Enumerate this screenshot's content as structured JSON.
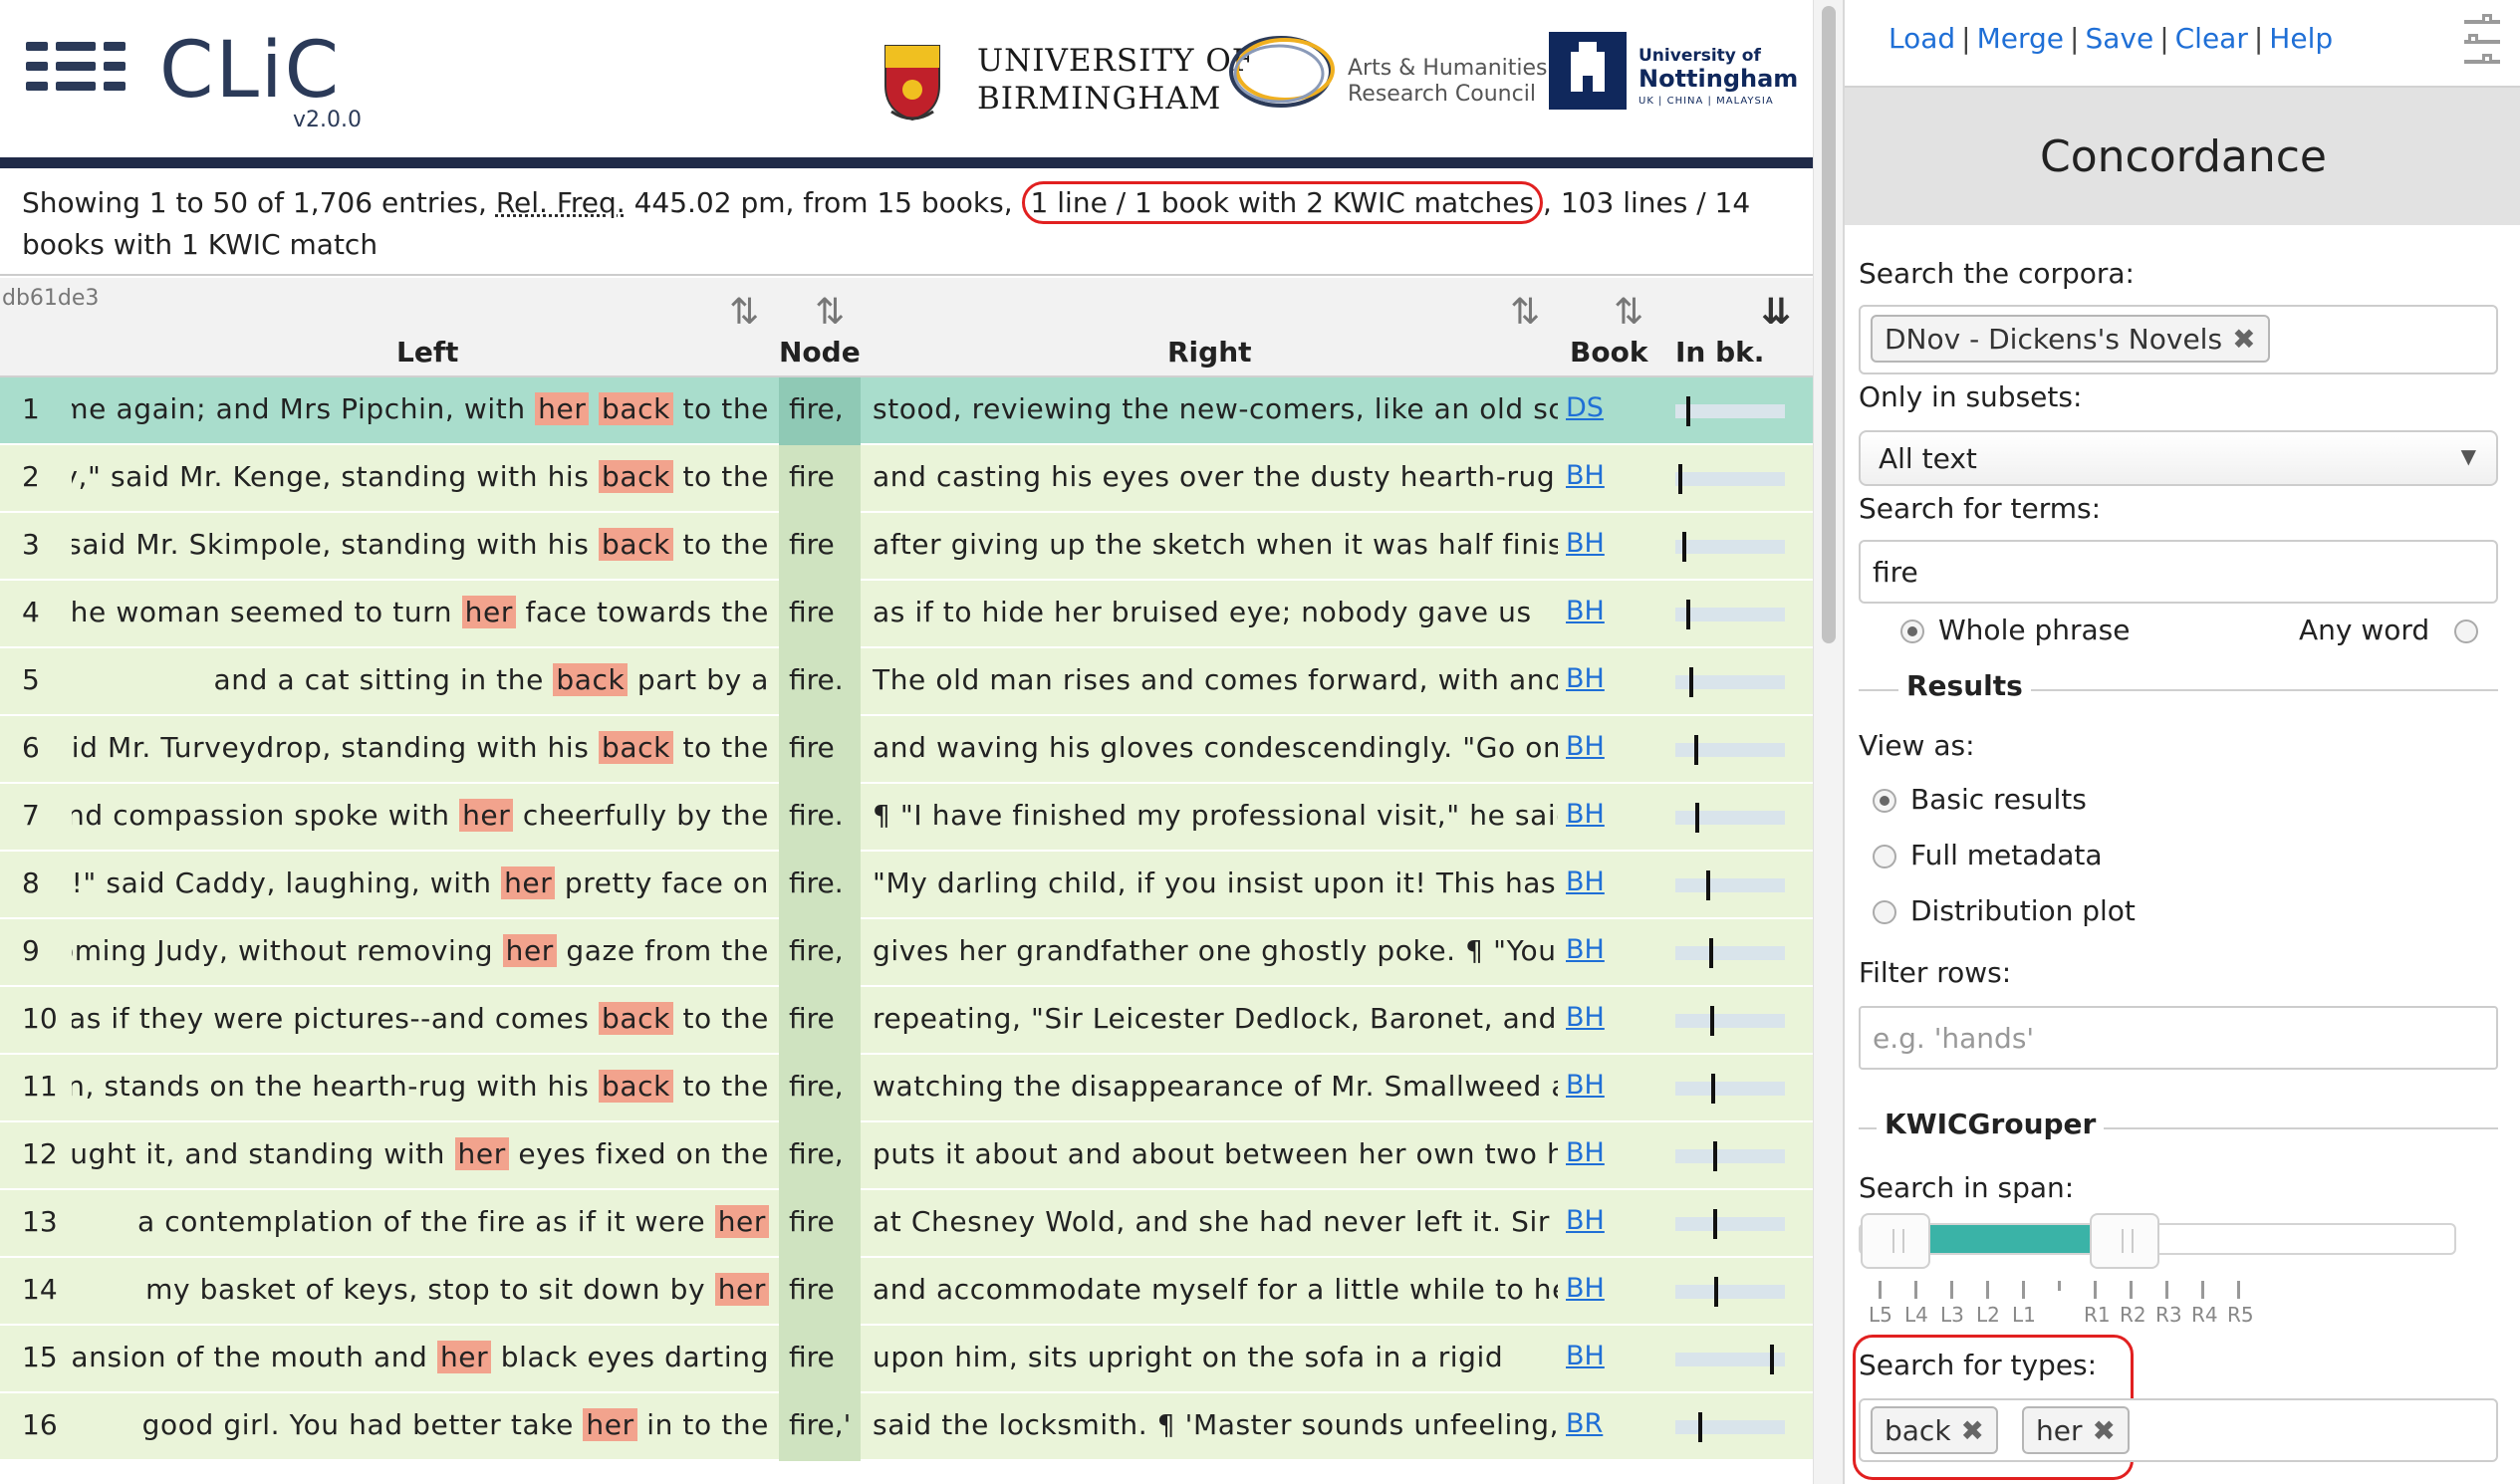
{
  "app": {
    "name": "CLiC",
    "version": "v2.0.0",
    "partners": {
      "birmingham_line1": "UNIVERSITY OF",
      "birmingham_line2": "BIRMINGHAM",
      "ahrc_line1": "Arts & Humanities",
      "ahrc_line2": "Research Council",
      "nottingham_line1": "University of",
      "nottingham_line2": "Nottingham",
      "nottingham_line3": "UK | CHINA | MALAYSIA"
    }
  },
  "summary": {
    "prefix": "Showing 1 to 50 of 1,706 entries, ",
    "relfreq_label": "Rel. Freq.",
    "middle": " 445.02 pm, from 15 books, ",
    "kwic_highlight": "1 line / 1 book with 2 KWIC matches",
    "suffix": ", 103 lines / 14 books with 1 KWIC match"
  },
  "table": {
    "hash": "db61de3",
    "headers": {
      "left": "Left",
      "node": "Node",
      "right": "Right",
      "book": "Book",
      "in_book": "In bk."
    },
    "sort_icon": "⇅",
    "sort_desc_icon": "⇊",
    "rows": [
      {
        "num": "1",
        "left": "ome again; and Mrs Pipchin, with |her| |back| to the",
        "node": "fire,",
        "right": "stood, reviewing the new-comers, like an old soldi",
        "book": "DS",
        "pos": 0.1,
        "selected": true
      },
      {
        "num": "2",
        "left": "by,\" said Mr. Kenge, standing with his |back| to the",
        "node": "fire",
        "right": "and casting his eyes over the dusty hearth-rug as",
        "book": "BH",
        "pos": 0.03,
        "selected": false
      },
      {
        "num": "3",
        "left": "\" said Mr. Skimpole, standing with his |back| to the",
        "node": "fire",
        "right": "after giving up the sketch when it was half finishe",
        "book": "BH",
        "pos": 0.07,
        "selected": false
      },
      {
        "num": "4",
        "left": "the woman seemed to turn |her| face towards the",
        "node": "fire",
        "right": "as if to hide her bruised eye; nobody gave us",
        "book": "BH",
        "pos": 0.1,
        "selected": false
      },
      {
        "num": "5",
        "left": "and a cat sitting in the |back| part by a",
        "node": "fire.",
        "right": "The old man rises and comes forward, with anothe",
        "book": "BH",
        "pos": 0.13,
        "selected": false
      },
      {
        "num": "6",
        "left": "said Mr. Turveydrop, standing with his |back| to the",
        "node": "fire",
        "right": "and waving his gloves condescendingly. \"Go on, m",
        "book": "BH",
        "pos": 0.18,
        "selected": false
      },
      {
        "num": "7",
        "left": "and compassion spoke with |her| cheerfully by the",
        "node": "fire.",
        "right": "¶ \"I have finished my professional visit,\" he said, c",
        "book": "BH",
        "pos": 0.19,
        "selected": false
      },
      {
        "num": "8",
        "left": "ng!\" said Caddy, laughing, with |her| pretty face on",
        "node": "fire.",
        "right": "\"My darling child, if you insist upon it! This has",
        "book": "BH",
        "pos": 0.29,
        "selected": false
      },
      {
        "num": "9",
        "left": "looming Judy, without removing |her| gaze from the",
        "node": "fire,",
        "right": "gives her grandfather one ghostly poke. ¶ \"You se",
        "book": "BH",
        "pos": 0.32,
        "selected": false
      },
      {
        "num": "10",
        "left": "as if they were pictures--and comes |back| to the",
        "node": "fire",
        "right": "repeating, \"Sir Leicester Dedlock, Baronet, and Ma",
        "book": "BH",
        "pos": 0.33,
        "selected": false
      },
      {
        "num": "11",
        "left": "ion, stands on the hearth-rug with his |back| to the",
        "node": "fire,",
        "right": "watching the disappearance of Mr. Smallweed and",
        "book": "BH",
        "pos": 0.34,
        "selected": false
      },
      {
        "num": "12",
        "left": "caught it, and standing with |her| eyes fixed on the",
        "node": "fire,",
        "right": "puts it about and about between her own two han",
        "book": "BH",
        "pos": 0.36,
        "selected": false
      },
      {
        "num": "13",
        "left": "a contemplation of the fire as if it were |her|",
        "node": "fire",
        "right": "at Chesney Wold, and she had never left it. Sir",
        "book": "BH",
        "pos": 0.36,
        "selected": false
      },
      {
        "num": "14",
        "left": "my basket of keys, stop to sit down by |her|",
        "node": "fire",
        "right": "and accommodate myself for a little while to her, a",
        "book": "BH",
        "pos": 0.37,
        "selected": false
      },
      {
        "num": "15",
        "left": "xpansion of the mouth and |her| black eyes darting",
        "node": "fire",
        "right": "upon him, sits upright on the sofa in a rigid",
        "book": "BH",
        "pos": 0.9,
        "selected": false
      },
      {
        "num": "16",
        "left": "good girl. You had better take |her| in to the",
        "node": "fire,'",
        "right": "said the locksmith. ¶ 'Master sounds unfeeling, mi",
        "book": "BR",
        "pos": 0.22,
        "selected": false
      }
    ]
  },
  "panel": {
    "links": [
      "Load",
      "Merge",
      "Save",
      "Clear",
      "Help"
    ],
    "title": "Concordance",
    "search_corpora_label": "Search the corpora:",
    "corpus_tag": "DNov - Dickens's Novels",
    "subsets_label": "Only in subsets:",
    "subset_value": "All text",
    "terms_label": "Search for terms:",
    "terms_value": "fire",
    "whole_phrase": "Whole phrase",
    "any_word": "Any word",
    "results_legend": "Results",
    "view_as_label": "View as:",
    "view_options": [
      "Basic results",
      "Full metadata",
      "Distribution plot"
    ],
    "view_selected": 0,
    "filter_label": "Filter rows:",
    "filter_placeholder": "e.g. 'hands'",
    "kwic_legend": "KWICGrouper",
    "span_label": "Search in span:",
    "span_ticks": [
      "L5",
      "L4",
      "L3",
      "L2",
      "L1",
      "",
      "R1",
      "R2",
      "R3",
      "R4",
      "R5"
    ],
    "types_label": "Search for types:",
    "type_tags": [
      "back",
      "her"
    ]
  }
}
